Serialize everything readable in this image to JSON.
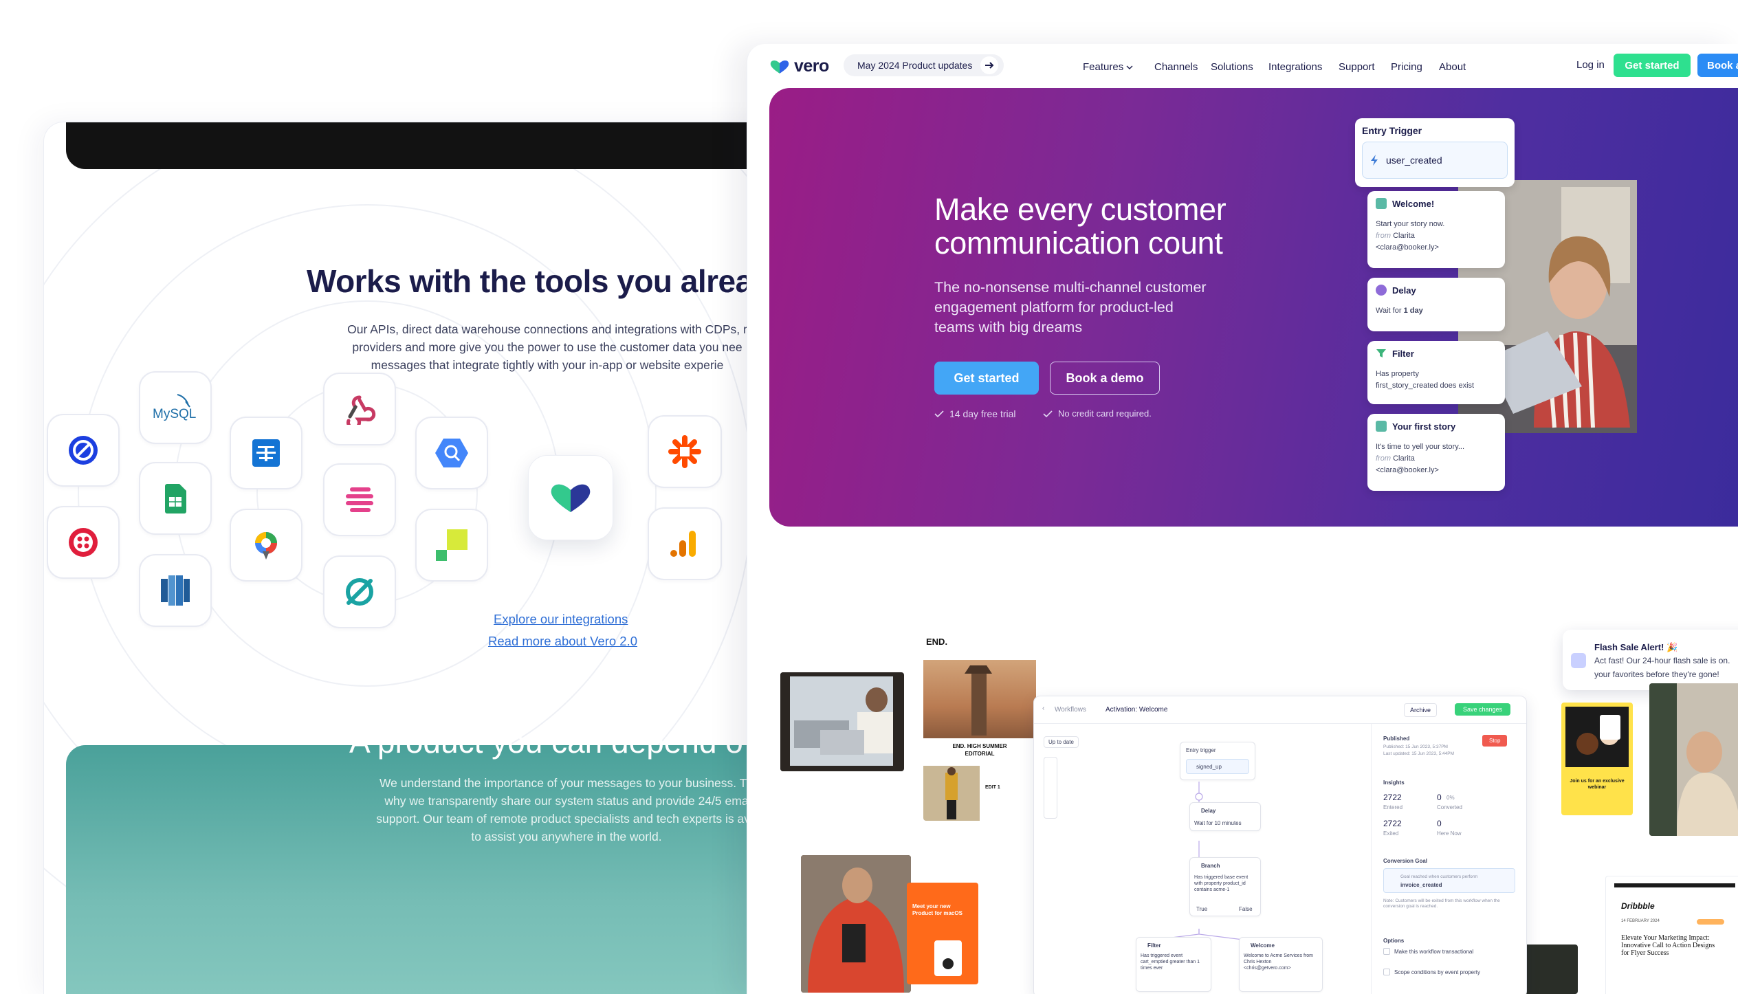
{
  "left": {
    "title": "Works with the tools you alrea",
    "desc": [
      "Our APIs, direct data warehouse connections and integrations with CDPs, r",
      "providers and more give you the power to use the customer data you nee",
      "messages that integrate tightly with your in-app or website experie"
    ],
    "icons": {
      "mysql_label": "MySQL"
    },
    "links": {
      "explore": "Explore our integrations",
      "read_more": "Read more about Vero 2.0"
    },
    "teal": {
      "title": "A product you can depend o",
      "desc": [
        "We understand the importance of your messages to your business. Th",
        "why we transparently share our system status and provide 24/5 ema",
        "support. Our team of remote product specialists and tech experts is ava",
        "to assist you anywhere in the world."
      ]
    }
  },
  "nav": {
    "logo": "vero",
    "pill": "May 2024 Product updates",
    "items": [
      "Features",
      "Channels",
      "Solutions",
      "Integrations",
      "Support",
      "Pricing",
      "About"
    ],
    "login": "Log in",
    "get_started": "Get started",
    "book": "Book a"
  },
  "hero": {
    "title": [
      "Make every customer",
      "communication count"
    ],
    "sub": [
      "The no-nonsense multi-channel customer",
      "engagement platform for product-led",
      "teams with big dreams"
    ],
    "btn_primary": "Get started",
    "btn_secondary": "Book a demo",
    "check1": "14 day free trial",
    "check2": "No credit card required.",
    "trigger_label": "Entry Trigger",
    "trigger_value": "user_created",
    "cards": [
      {
        "title": "Welcome!",
        "l1": "Start your story now.",
        "from": "from",
        "l2": "Clarita",
        "l3": "<clara@booker.ly>"
      },
      {
        "title": "Delay",
        "l1": "Wait for",
        "bold": "1 day"
      },
      {
        "title": "Filter",
        "l1": "Has property",
        "l2": "first_story_created does exist"
      },
      {
        "title": "Your first story",
        "l1": "It's time to yell your story...",
        "from": "from",
        "l2": "Clarita",
        "l3": "<clara@booker.ly>"
      }
    ]
  },
  "collage": {
    "end_logo": "END.",
    "end_caption": "END. HIGH SUMMER EDITORIAL",
    "end_edit": "EDIT 1",
    "mac_title": "Meet your new Product for macOS",
    "toast_title": "Flash Sale Alert! 🎉",
    "toast_l1": "Act fast! Our 24-hour flash sale is on.",
    "toast_l2": "your favorites before they're gone!",
    "webinar": "Join us for an exclusive webinar",
    "dribbble": "Dribbble",
    "dribbble_date": "14 FEBRUARY 2024",
    "dribbble_head": "Elevate Your Marketing Impact: Innovative Call to Action Designs for Flyer Success",
    "workflow": {
      "crumb": "Workflows",
      "title": "Activation: Welcome",
      "archive": "Archive",
      "save": "Save changes",
      "up_to_date": "Up to date",
      "entry": "Entry trigger",
      "signed_up": "signed_up",
      "delay": "Delay",
      "delay_text": "Wait for 10 minutes",
      "branch": "Branch",
      "branch_text": "Has triggered base event with property product_id contains acme-1",
      "true": "True",
      "false": "False",
      "filter": "Filter",
      "filter_text": "Has triggered event cart_emptied greater than 1 times ever",
      "welcome": "Welcome",
      "welcome_text": "Welcome to Acme Services from Chris Hexton <chris@getvero.com>",
      "published": "Published",
      "published_meta": "Published: 15 Jun 2023, 5:37PM",
      "updated_meta": "Last updated: 15 Jun 2023, 5:44PM",
      "stop": "Stop",
      "insights": "Insights",
      "entered_v": "2722",
      "entered": "Entered",
      "converted_v": "0",
      "converted": "Converted",
      "converted_pct": "0%",
      "exited_v": "2722",
      "exited": "Exited",
      "here_v": "0",
      "here": "Here Now",
      "goal": "Conversion Goal",
      "goal_text": "Goal reached when customers perform",
      "goal_event": "invoice_created",
      "note": "Note: Customers will be exited from this workflow when the conversion goal is reached.",
      "options": "Options",
      "opt1": "Make this workflow transactional",
      "opt2": "Scope conditions by event property"
    }
  }
}
